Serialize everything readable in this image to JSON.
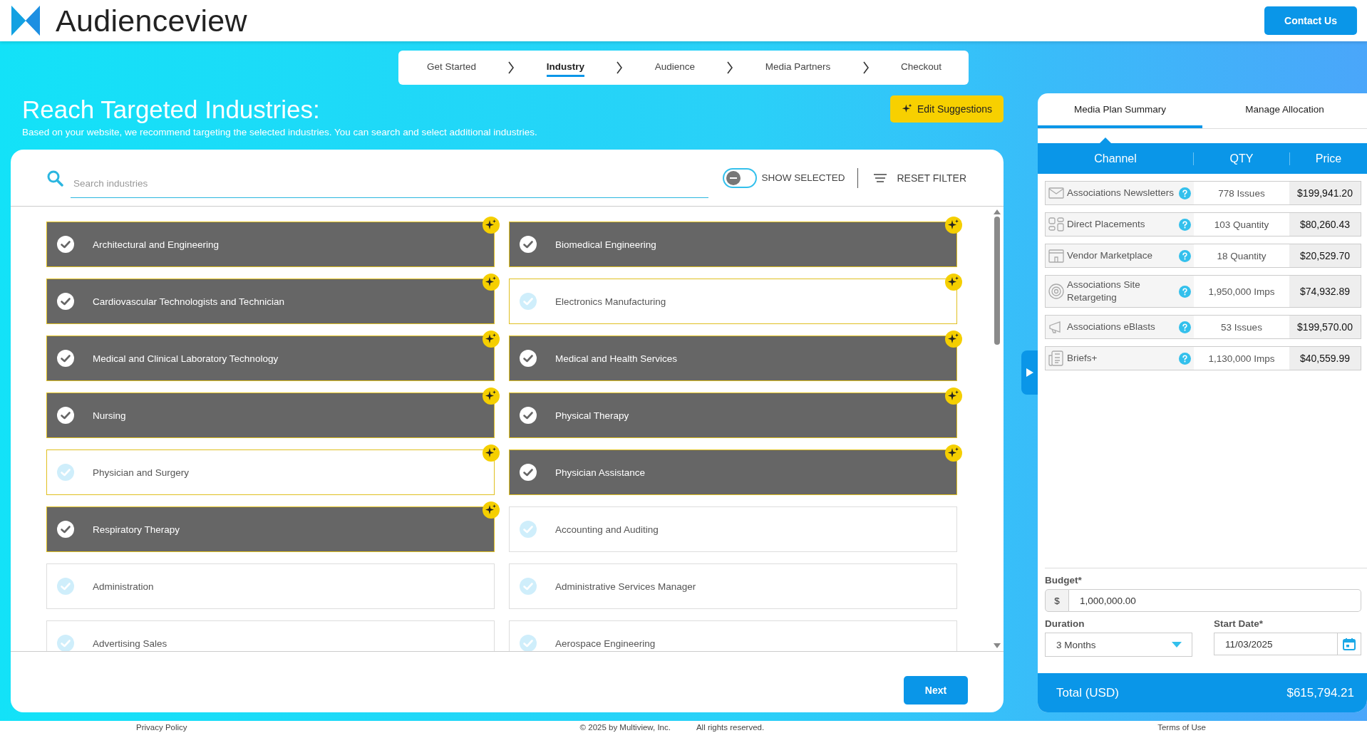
{
  "brand": {
    "name": "Audienceview"
  },
  "header": {
    "contact_button": "Contact Us"
  },
  "steps": [
    {
      "label": "Get Started",
      "selected": false
    },
    {
      "label": "Industry",
      "selected": true
    },
    {
      "label": "Audience",
      "selected": false
    },
    {
      "label": "Media Partners",
      "selected": false
    },
    {
      "label": "Checkout",
      "selected": false
    }
  ],
  "page": {
    "title": "Reach Targeted Industries:",
    "subtitle": "Based on your website, we recommend targeting the selected industries. You can search and select additional industries.",
    "edit_button": "Edit Suggestions"
  },
  "filter": {
    "search_placeholder": "Search industries",
    "show_selected": {
      "label": "SHOW SELECTED",
      "on": false
    },
    "reset": "RESET FILTER"
  },
  "industries": [
    {
      "label": "Architectural and Engineering",
      "selected": true,
      "suggested": true
    },
    {
      "label": "Biomedical Engineering",
      "selected": true,
      "suggested": true
    },
    {
      "label": "Cardiovascular Technologists and Technician",
      "selected": true,
      "suggested": true
    },
    {
      "label": "Electronics Manufacturing",
      "selected": false,
      "suggested": true
    },
    {
      "label": "Medical and Clinical Laboratory Technology",
      "selected": true,
      "suggested": true
    },
    {
      "label": "Medical and Health Services",
      "selected": true,
      "suggested": true
    },
    {
      "label": "Nursing",
      "selected": true,
      "suggested": true
    },
    {
      "label": "Physical Therapy",
      "selected": true,
      "suggested": true
    },
    {
      "label": "Physician and Surgery",
      "selected": false,
      "suggested": true
    },
    {
      "label": "Physician Assistance",
      "selected": true,
      "suggested": true
    },
    {
      "label": "Respiratory Therapy",
      "selected": true,
      "suggested": true
    },
    {
      "label": "Accounting and Auditing",
      "selected": false,
      "suggested": false
    },
    {
      "label": "Administration",
      "selected": false,
      "suggested": false
    },
    {
      "label": "Administrative Services Manager",
      "selected": false,
      "suggested": false
    },
    {
      "label": "Advertising Sales",
      "selected": false,
      "suggested": false
    },
    {
      "label": "Aerospace Engineering",
      "selected": false,
      "suggested": false
    }
  ],
  "next_button": "Next",
  "summary": {
    "tabs": [
      {
        "label": "Media Plan Summary",
        "selected": true
      },
      {
        "label": "Manage Allocation",
        "selected": false
      }
    ],
    "columns": [
      "Channel",
      "QTY",
      "Price"
    ],
    "rows": [
      {
        "kind": "mail",
        "channel": "Associations Newsletters",
        "qty": "778 Issues",
        "price": "$199,941.20"
      },
      {
        "kind": "grid",
        "channel": "Direct Placements",
        "qty": "103 Quantity",
        "price": "$80,260.43"
      },
      {
        "kind": "store",
        "channel": "Vendor Marketplace",
        "qty": "18 Quantity",
        "price": "$20,529.70"
      },
      {
        "kind": "target",
        "channel": "Associations Site Retargeting",
        "qty": "1,950,000 Imps",
        "price": "$74,932.89"
      },
      {
        "kind": "megaphone",
        "channel": "Associations eBlasts",
        "qty": "53 Issues",
        "price": "$199,570.00"
      },
      {
        "kind": "document",
        "channel": "Briefs+",
        "qty": "1,130,000 Imps",
        "price": "$40,559.99"
      }
    ],
    "budget": {
      "label": "Budget*",
      "prefix": "$",
      "value": "1,000,000.00"
    },
    "duration": {
      "label": "Duration",
      "value": "3 Months"
    },
    "start_date": {
      "label": "Start Date*",
      "value": "11/03/2025"
    },
    "total": {
      "label": "Total (USD)",
      "value": "$615,794.21"
    }
  },
  "footer": {
    "privacy": "Privacy Policy",
    "copyright": "© 2025 by Multiview, Inc.",
    "rights": "All rights reserved.",
    "terms": "Terms of Use"
  }
}
